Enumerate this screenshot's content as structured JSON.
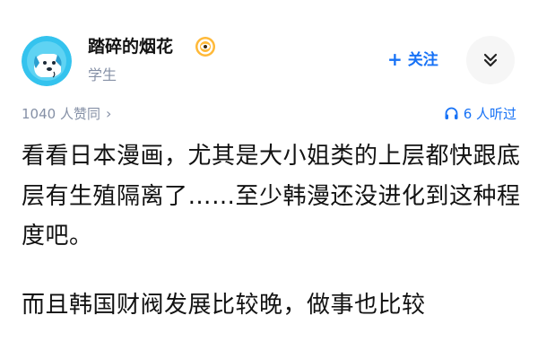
{
  "author": {
    "name": "踏碎的烟花",
    "description": "学生",
    "avatar_icon": "dog-avatar-icon",
    "badge_icon": "eye-badge-icon"
  },
  "actions": {
    "follow_label": "关注",
    "more_icon": "chevron-double-down-icon"
  },
  "meta": {
    "likes_label": "1040 人赞同",
    "listen_label": "6 人听过",
    "listen_icon": "headphones-icon"
  },
  "content": {
    "paragraphs": [
      "看看日本漫画，尤其是大小姐类的上层都快跟底层有生殖隔离了……至少韩漫还没进化到这种程度吧。",
      "而且韩国财阀发展比较晚，做事也比较"
    ]
  },
  "colors": {
    "accent": "#1772f6",
    "muted": "#8590a6",
    "text": "#121212"
  }
}
